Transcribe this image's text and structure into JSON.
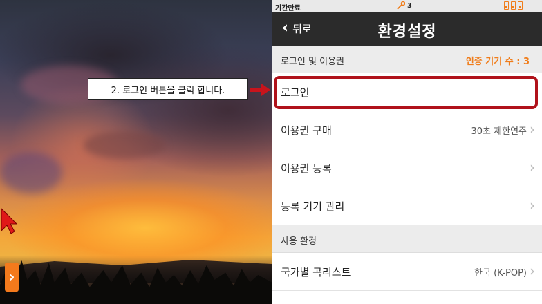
{
  "callout": {
    "text": "2. 로그인 버튼을 클릭 합니다."
  },
  "colors": {
    "accent": "#f07d1b",
    "highlight": "#b0121b",
    "navbar": "#2b2b2b"
  },
  "status": {
    "left_text": "기간만료",
    "signal_count": "3"
  },
  "header": {
    "back_label": "뒤로",
    "title": "환경설정"
  },
  "sections": [
    {
      "label": "로그인 및 이용권",
      "right_text": "인증 기기 수 : 3"
    },
    {
      "label": "사용 환경"
    }
  ],
  "rows": [
    {
      "label": "로그인",
      "value": ""
    },
    {
      "label": "이용권 구매",
      "value": "30초 제한연주"
    },
    {
      "label": "이용권 등록",
      "value": ""
    },
    {
      "label": "등록 기기 관리",
      "value": ""
    },
    {
      "label": "국가별 곡리스트",
      "value": "한국 (K-POP)"
    }
  ],
  "icons": {
    "back": "chevron-left-icon",
    "row_chevron": "chevron-right-icon",
    "next": "chevron-right-icon",
    "cursor": "mouse-pointer-icon"
  }
}
